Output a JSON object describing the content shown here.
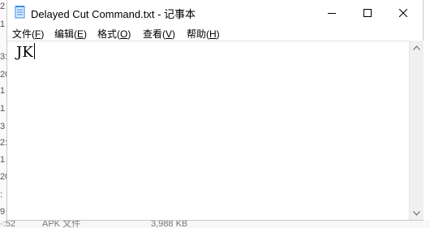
{
  "window": {
    "title": "Delayed Cut Command.txt - 记事本"
  },
  "menu": {
    "file": {
      "label": "文件(",
      "key": "F",
      "tail": ")"
    },
    "edit": {
      "label": "编辑(",
      "key": "E",
      "tail": ")"
    },
    "format": {
      "label": "格式(",
      "key": "O",
      "tail": ")"
    },
    "view": {
      "label": "查看(",
      "key": "V",
      "tail": ")"
    },
    "help": {
      "label": "帮助(",
      "key": "H",
      "tail": ")"
    }
  },
  "editor": {
    "content": "JK"
  },
  "background": {
    "left_chars": [
      "2",
      "1",
      "3:",
      "20",
      "1",
      "1",
      "3",
      "2:",
      "1",
      "20",
      ":",
      "9"
    ],
    "bottom_fragments": [
      "·:52",
      "APK 文件",
      "3,988 KB"
    ]
  },
  "colors": {
    "close_hover": "#e81123",
    "icon_blue": "#3c8de6"
  }
}
